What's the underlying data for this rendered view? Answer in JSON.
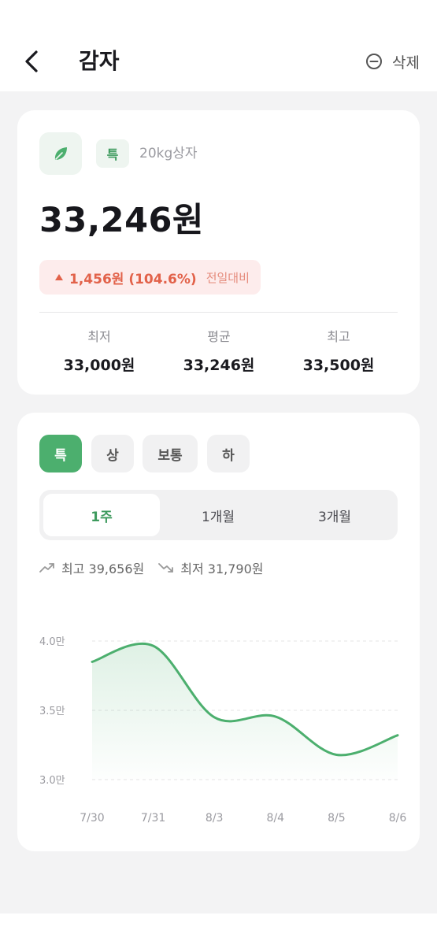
{
  "header": {
    "title": "감자",
    "delete_label": "삭제"
  },
  "summary": {
    "grade_badge": "특",
    "unit": "20kg상자",
    "price": "33,246원",
    "change_amount": "1,456원 (104.6%)",
    "change_compare": "전일대비",
    "stats": [
      {
        "label": "최저",
        "value": "33,000원"
      },
      {
        "label": "평균",
        "value": "33,246원"
      },
      {
        "label": "최고",
        "value": "33,500원"
      }
    ]
  },
  "grades": {
    "tabs": [
      "특",
      "상",
      "보통",
      "하"
    ],
    "selected": "특"
  },
  "periods": {
    "options": [
      "1주",
      "1개월",
      "3개월"
    ],
    "selected": "1주"
  },
  "range": {
    "high_label": "최고 39,656원",
    "low_label": "최저 31,790원"
  },
  "icons": {
    "back": "chevron-left-icon",
    "delete": "minus-circle-icon",
    "produce": "leaf-icon",
    "change": "triangle-up-icon",
    "high": "trending-up-icon",
    "low": "trending-down-icon"
  },
  "colors": {
    "accent_green": "#4caf6e",
    "increase_red": "#e2624a"
  },
  "chart_data": {
    "type": "area",
    "x": [
      "7/30",
      "7/31",
      "8/3",
      "8/4",
      "8/5",
      "8/6"
    ],
    "series": [
      {
        "values": [
          38500,
          39650,
          34500,
          34550,
          31790,
          33200
        ]
      }
    ],
    "yticks": [
      "3.0만",
      "3.5만",
      "4.0만"
    ],
    "ytick_values": [
      30000,
      35000,
      40000
    ],
    "ylim": [
      30000,
      40000
    ],
    "grid": true
  }
}
